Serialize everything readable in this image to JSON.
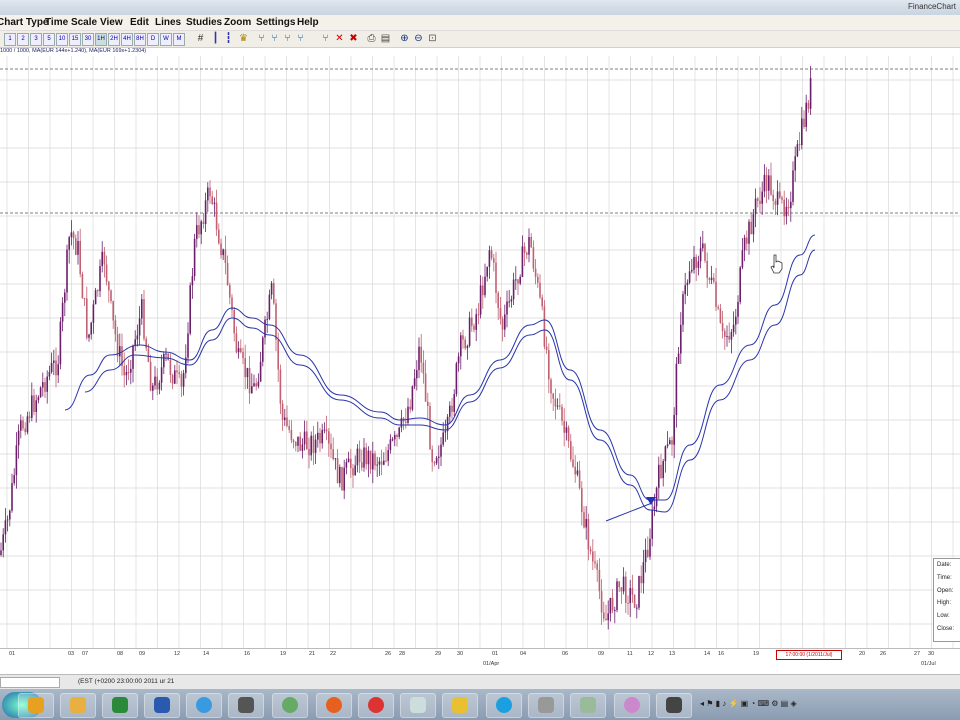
{
  "window": {
    "title": "FinanceChart"
  },
  "menu": [
    "Chart Type",
    "Time Scale",
    "View",
    "Edit",
    "Lines",
    "Studies",
    "Zoom",
    "Settings",
    "Help"
  ],
  "toolbar": {
    "timeframes": [
      "1",
      "2",
      "3",
      "5",
      "10",
      "15",
      "30",
      "1H",
      "2H",
      "4H",
      "8H",
      "D",
      "W",
      "M"
    ],
    "selected": "1H"
  },
  "legend_text": "1000 / 1000, MA(EUR 144x+1.240), MA(EUR 169x+1.2304)",
  "x_axis": {
    "top_labels": [
      "01",
      "03",
      "07",
      "08",
      "09",
      "12",
      "14",
      "16",
      "19",
      "21",
      "22",
      "26",
      "28",
      "29",
      "30",
      "01",
      "04",
      "06",
      "09",
      "11",
      "12",
      "13",
      "14",
      "16",
      "19",
      "20",
      "26",
      "27",
      "30",
      "01"
    ],
    "bottom_labels": [
      "01/Apr",
      "01/Jul"
    ]
  },
  "cursor_label": "17:00:00 (1/2011/Jul)",
  "info_box": [
    "Date:",
    "Time:",
    "Open:",
    "High:",
    "Low:",
    "Close:"
  ],
  "status": {
    "input_field": "",
    "text": "(EST (+0200  23:00:00 2011 ur 21"
  },
  "taskbar_icons": [
    "start-orb-icon",
    "media-player-icon",
    "folder-icon",
    "excel-icon",
    "word-icon",
    "ie-icon",
    "chart-app-icon",
    "globe-icon",
    "firefox-icon",
    "chrome-icon",
    "mail-icon",
    "notes-icon",
    "skype-icon",
    "chart-icon",
    "ledger-icon",
    "tools-icon",
    "chat-icon"
  ],
  "colors": {
    "candle_up": "#6a1f6a",
    "candle_down": "#c06070",
    "ma": "#2233aa",
    "grid": "#d9d9d9",
    "dashed": "#555555",
    "accent_cursor": "#cc0000"
  }
}
